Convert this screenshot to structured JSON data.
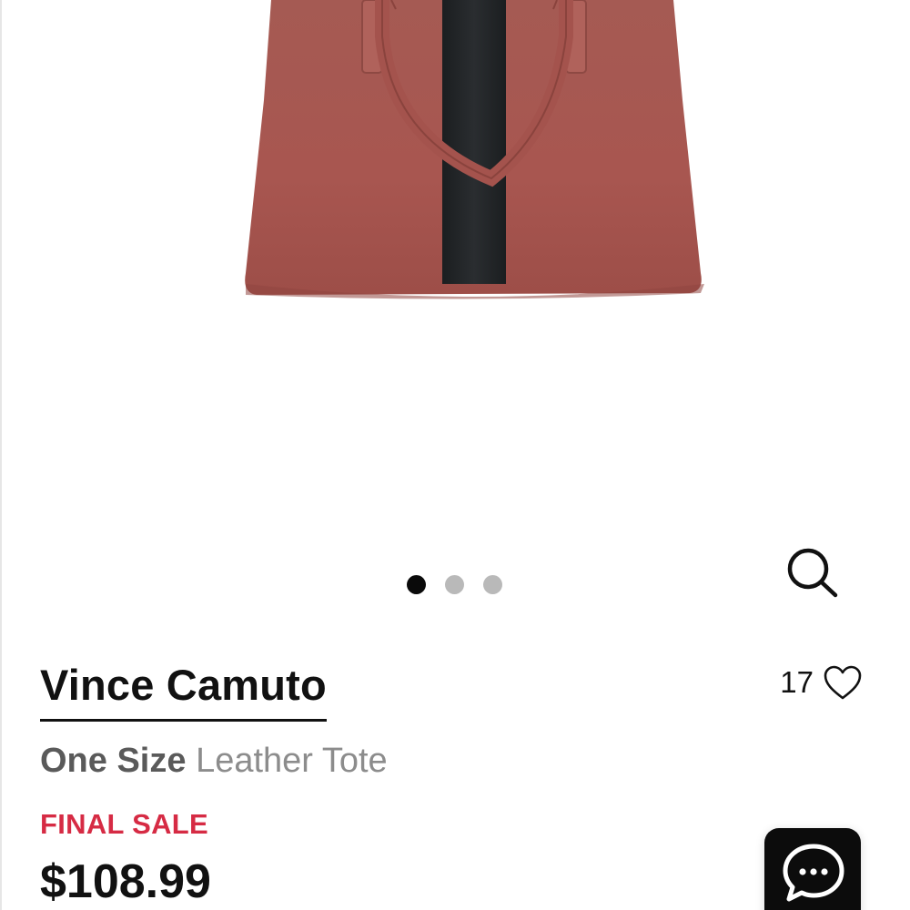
{
  "product": {
    "brand": "Vince Camuto",
    "size_label": "One Size",
    "name": "Leather Tote",
    "sale_label": "FINAL SALE",
    "price": "$108.99",
    "like_count": "17"
  },
  "carousel": {
    "total": 3,
    "active_index": 0
  },
  "icons": {
    "zoom": "search-icon",
    "like": "heart-icon",
    "chat": "chat-bubble-icon"
  },
  "colors": {
    "sale": "#d62b44",
    "text": "#111111",
    "size_text": "#5a5a5a",
    "name_text": "#8c8c8c",
    "dot_active": "#0a0a0a",
    "dot_inactive": "#b9b9b9",
    "bag": "#a55750",
    "stripe": "#1f2224"
  }
}
